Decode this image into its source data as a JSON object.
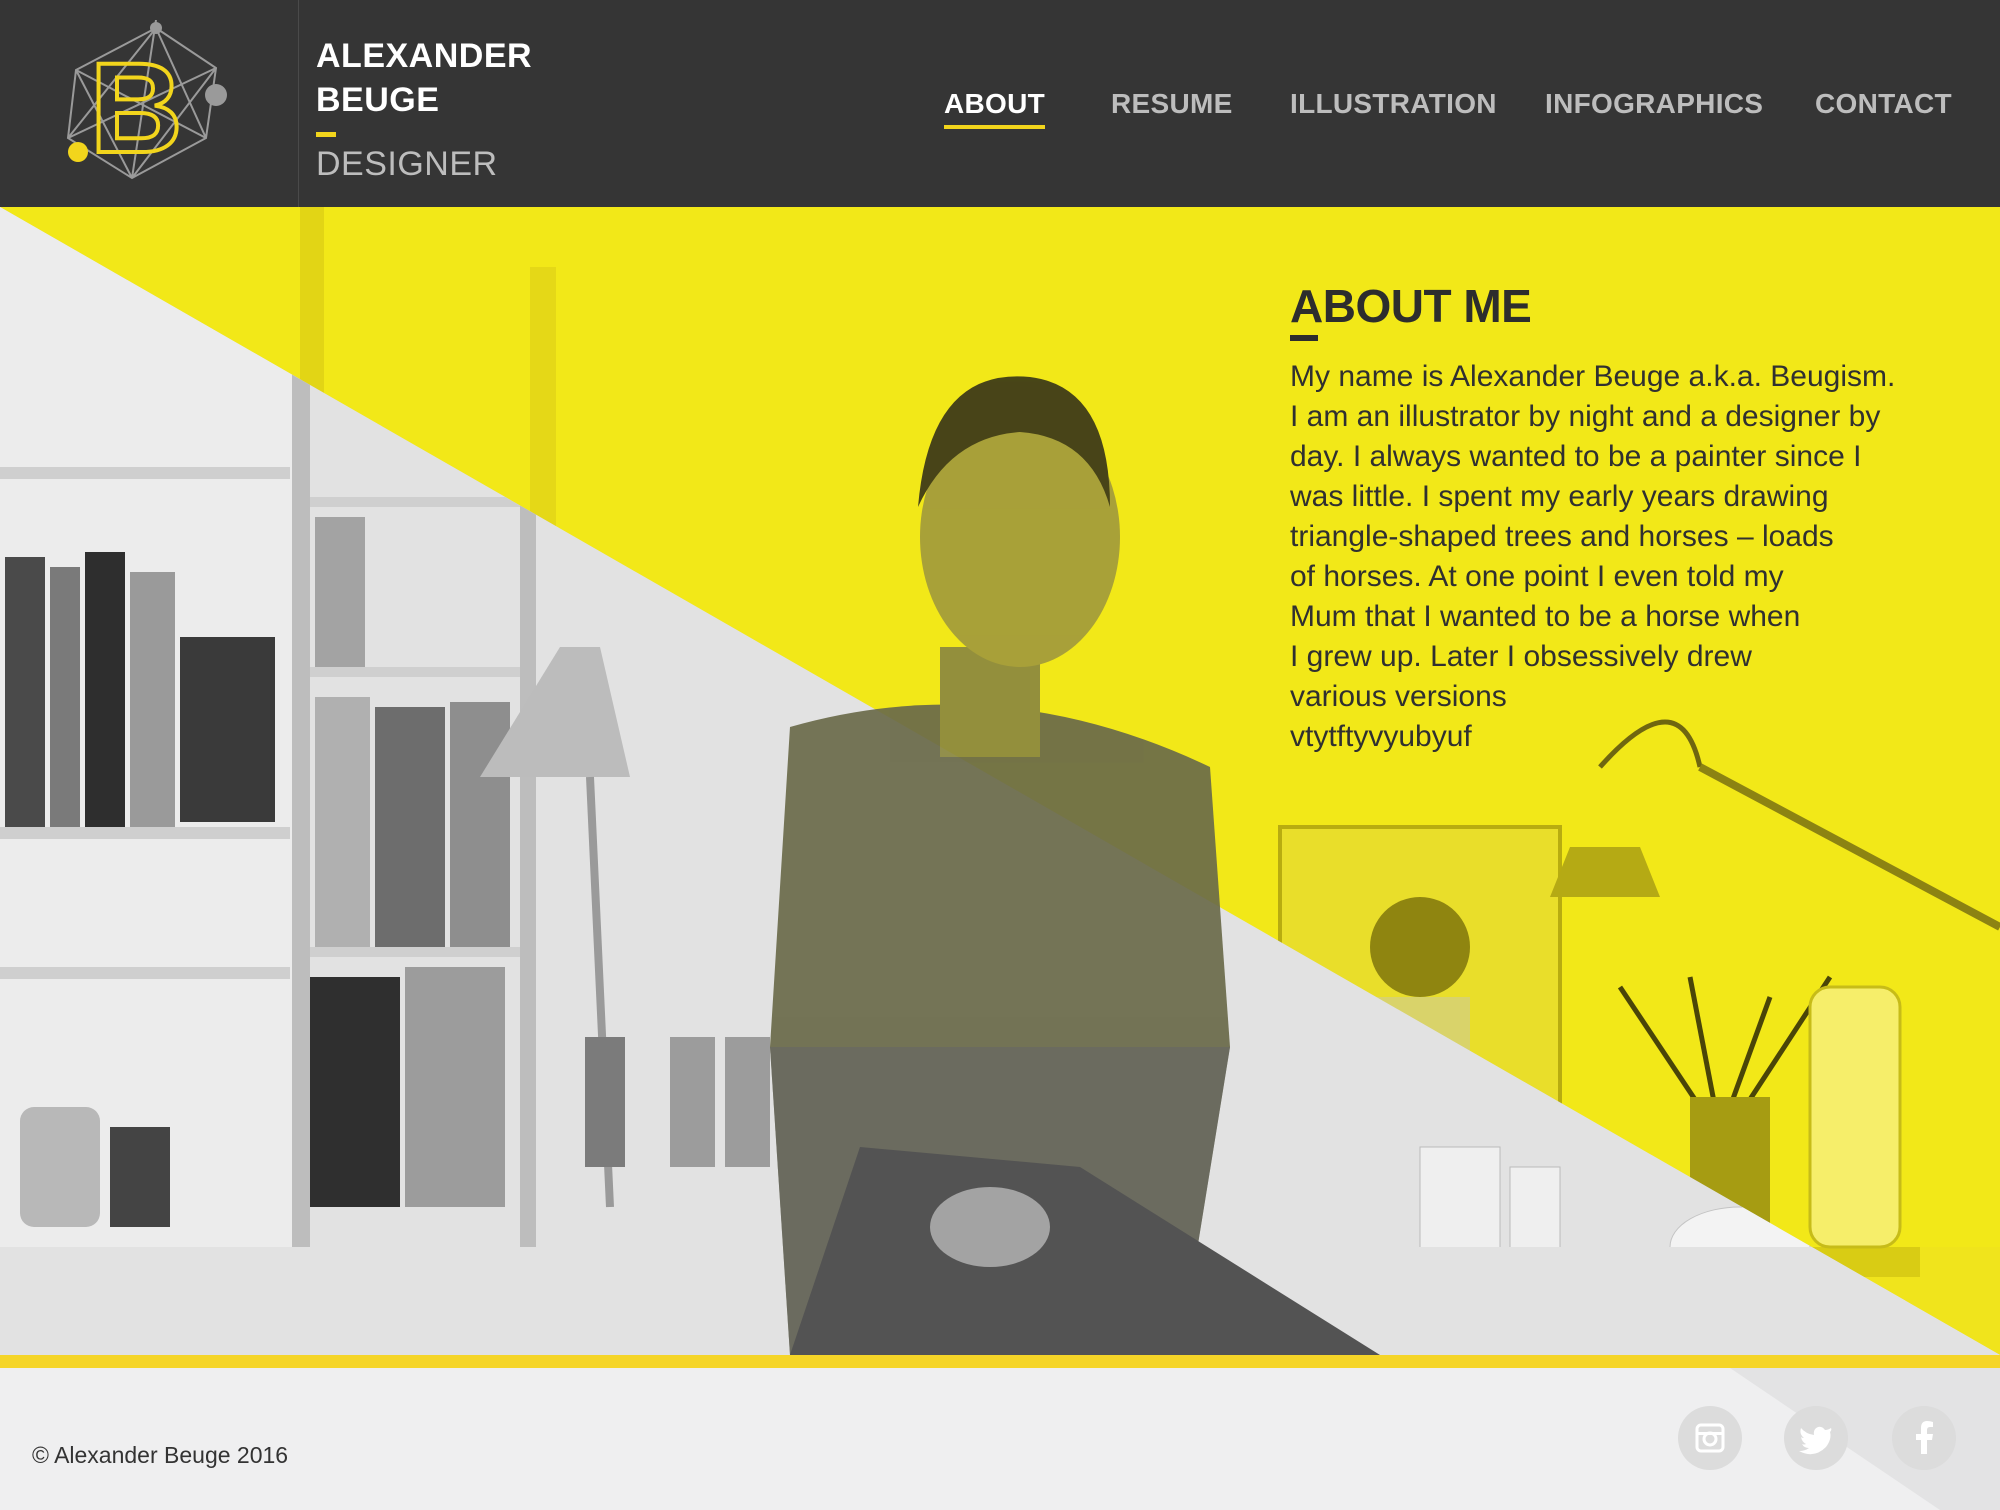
{
  "header": {
    "brand_line1": "ALEXANDER",
    "brand_line2": "BEUGE",
    "brand_role": "DESIGNER",
    "logo_letter": "B"
  },
  "nav": {
    "items": [
      {
        "label": "ABOUT",
        "active": true
      },
      {
        "label": "RESUME",
        "active": false
      },
      {
        "label": "ILLUSTRATION",
        "active": false
      },
      {
        "label": "INFOGRAPHICS",
        "active": false
      },
      {
        "label": "CONTACT",
        "active": false
      }
    ]
  },
  "about": {
    "title": "ABOUT ME",
    "text": "My name is Alexander Beuge a.k.a. Beugism.\nI am an illustrator by night and a designer by\nday. I always wanted to be a painter since I\nwas little. I spent my early years drawing\ntriangle-shaped trees and horses – loads\nof horses. At one point I even told my\nMum that I wanted to be a horse when\nI grew up. Later I obsessively drew\nvarious versions\nvtytftyvyubyuf"
  },
  "footer": {
    "copyright": "© Alexander Beuge 2016",
    "social": [
      {
        "icon": "instagram-icon"
      },
      {
        "icon": "twitter-icon"
      },
      {
        "icon": "facebook-icon"
      }
    ]
  },
  "colors": {
    "header_bg": "#353535",
    "accent_yellow": "#f2d51c",
    "hero_yellow": "#f2e818",
    "footer_bg": "#efeff0",
    "text_dark": "#2d2d2d"
  }
}
